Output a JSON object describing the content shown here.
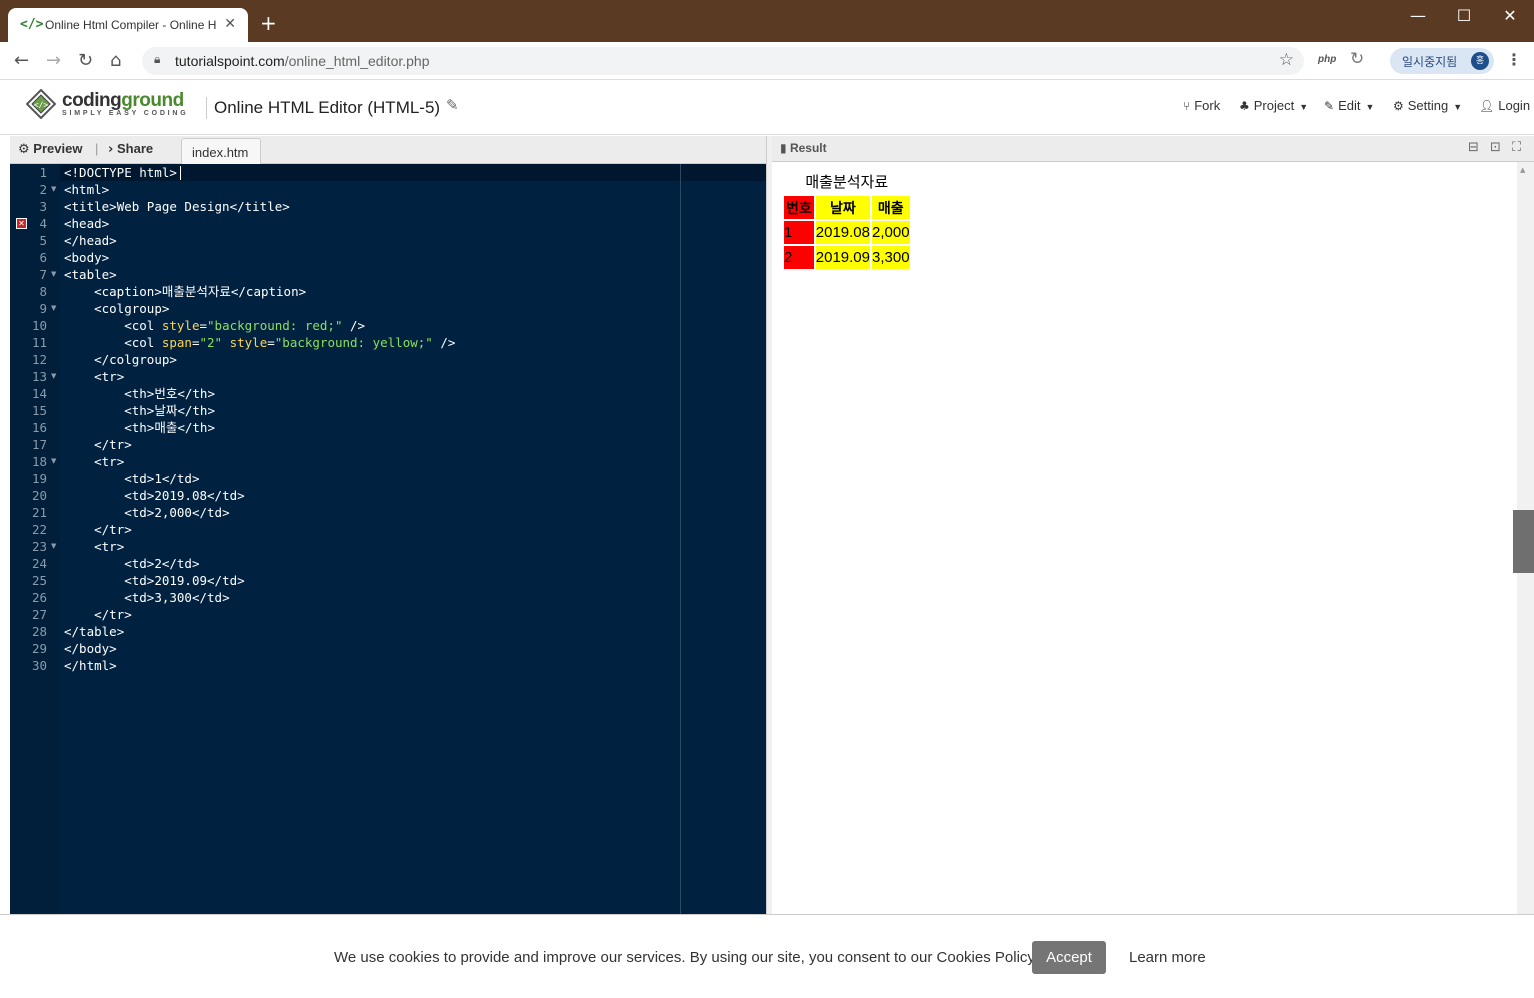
{
  "browser": {
    "tab_title": "Online Html Compiler - Online H",
    "tab_favicon": "</>",
    "new_tab": "+",
    "url_domain": "tutorialspoint.com",
    "url_path": "/online_html_editor.php",
    "ext_php": "php",
    "profile_label": "일시중지됨",
    "profile_initial": "홍",
    "window_controls": [
      "—",
      "☐",
      "✕"
    ]
  },
  "site": {
    "logo_name_1": "coding",
    "logo_name_2": "ground",
    "logo_tagline": "SIMPLY EASY CODING",
    "page_title": "Online HTML Editor (HTML-5)",
    "menu": {
      "fork": "Fork",
      "project": "Project",
      "edit": "Edit",
      "setting": "Setting",
      "login": "Login"
    }
  },
  "editor": {
    "preview_label": "Preview",
    "share_label": "Share",
    "file_tab": "index.htm",
    "error_line": 4,
    "line_numbers": [
      "1",
      "2",
      "3",
      "4",
      "5",
      "6",
      "7",
      "8",
      "9",
      "10",
      "11",
      "12",
      "13",
      "14",
      "15",
      "16",
      "17",
      "18",
      "19",
      "20",
      "21",
      "22",
      "23",
      "24",
      "25",
      "26",
      "27",
      "28",
      "29",
      "30"
    ],
    "lines": [
      "<!DOCTYPE html>",
      "<html>",
      "<title>Web Page Design</title>",
      "<head>",
      "</head>",
      "<body>",
      "<table>",
      "    <caption>매출분석자료</caption>",
      "    <colgroup>",
      "        <col style=\"background: red;\" />",
      "        <col span=\"2\" style=\"background: yellow;\" />",
      "    </colgroup>",
      "    <tr>",
      "        <th>번호</th>",
      "        <th>날짜</th>",
      "        <th>매출</th>",
      "    </tr>",
      "    <tr>",
      "        <td>1</td>",
      "        <td>2019.08</td>",
      "        <td>2,000</td>",
      "    </tr>",
      "    <tr>",
      "        <td>2</td>",
      "        <td>2019.09</td>",
      "        <td>3,300</td>",
      "    </tr>",
      "</table>",
      "</body>",
      "</html>"
    ]
  },
  "result": {
    "label": "Result",
    "caption": "매출분석자료",
    "headers": [
      "번호",
      "날짜",
      "매출"
    ],
    "rows": [
      [
        "1",
        "2019.08",
        "2,000"
      ],
      [
        "2",
        "2019.09",
        "3,300"
      ]
    ],
    "colors": {
      "first_col": "#ff0000",
      "other_cols": "#ffff00"
    }
  },
  "cookie": {
    "text": "We use cookies to provide and improve our services. By using our site, you consent to our Cookies Policy.",
    "accept": "Accept",
    "learn_more": "Learn more"
  }
}
